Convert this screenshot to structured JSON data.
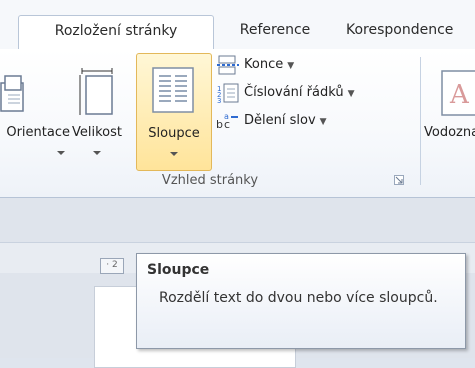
{
  "tabs": [
    {
      "label": "Rozložení stránky",
      "active": true
    },
    {
      "label": "Reference",
      "active": false
    },
    {
      "label": "Korespondence",
      "active": false
    }
  ],
  "ribbon": {
    "buttons": {
      "orientation": "Orientace",
      "size": "Velikost",
      "columns": "Sloupce",
      "watermark": "Vodoznak"
    },
    "small_items": {
      "breaks": "Konce",
      "line_numbers": "Číslování řádků",
      "hyphenation": "Dělení slov"
    },
    "group_label": "Vzhled stránky"
  },
  "tooltip": {
    "title": "Sloupce",
    "body": "Rozdělí text do dvou nebo více sloupců."
  },
  "colors": {
    "highlight_fill": "#ffe49a",
    "highlight_border": "#e3b85a",
    "ribbon_border": "#b6c3d6"
  }
}
